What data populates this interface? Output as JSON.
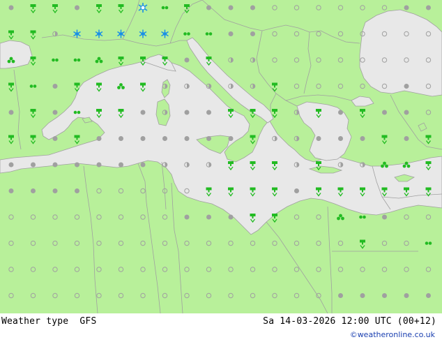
{
  "footer": {
    "title": "Weather type",
    "model": "GFS",
    "datetime": "Sa 14-03-2026 12:00 UTC (00+12)",
    "credit": "©weatheronline.co.uk"
  },
  "colors": {
    "land": "#b8f09a",
    "sea": "#e8e8e8",
    "border": "#a0a0a0",
    "rain": "#22bb22",
    "snow": "#1a8fe6",
    "dot": "#a0a0a0"
  },
  "symbols_legend": {
    "dot_filled": "cloudy",
    "dot_open": "clear",
    "dot_half": "partly cloudy",
    "rain_icon": "rain",
    "snow_icon": "snow",
    "drizzle_icon": "drizzle",
    "shower_icon": "showers"
  },
  "grid_symbols": [
    [
      "d",
      "r",
      "r",
      "f",
      "r",
      "r",
      "s",
      "dz",
      "r",
      "f",
      "f",
      "f",
      "o",
      "o",
      "o",
      "o",
      "o",
      "o",
      "f",
      "f"
    ],
    [
      "r",
      "r",
      "h",
      "sn",
      "sn",
      "sn",
      "sn",
      "sn",
      "dz",
      "dz",
      "f",
      "f",
      "o",
      "o",
      "o",
      "o",
      "o",
      "o",
      "o",
      "o"
    ],
    [
      "sh",
      "r",
      "dz",
      "dz",
      "sh",
      "r",
      "r",
      "r",
      "f",
      "r",
      "h",
      "h",
      "o",
      "o",
      "o",
      "o",
      "o",
      "o",
      "o",
      "o"
    ],
    [
      "r",
      "dz",
      "f",
      "r",
      "r",
      "sh",
      "r",
      "h",
      "h",
      "h",
      "h",
      "h",
      "r",
      "o",
      "o",
      "o",
      "o",
      "o",
      "f",
      "o"
    ],
    [
      "f",
      "r",
      "f",
      "dz",
      "r",
      "r",
      "f",
      "h",
      "f",
      "f",
      "r",
      "r",
      "r",
      "h",
      "r",
      "f",
      "r",
      "f",
      "f",
      "o"
    ],
    [
      "r",
      "r",
      "f",
      "r",
      "f",
      "f",
      "f",
      "f",
      "f",
      "f",
      "f",
      "r",
      "h",
      "h",
      "f",
      "f",
      "f",
      "r",
      "f",
      "r"
    ],
    [
      "f",
      "f",
      "f",
      "f",
      "f",
      "f",
      "f",
      "h",
      "h",
      "h",
      "r",
      "r",
      "r",
      "h",
      "r",
      "h",
      "h",
      "sh",
      "sh",
      "r"
    ],
    [
      "f",
      "f",
      "f",
      "f",
      "o",
      "o",
      "o",
      "o",
      "o",
      "r",
      "r",
      "r",
      "r",
      "f",
      "r",
      "r",
      "r",
      "r",
      "r",
      "r"
    ],
    [
      "o",
      "o",
      "o",
      "o",
      "o",
      "o",
      "o",
      "o",
      "f",
      "f",
      "f",
      "r",
      "r",
      "o",
      "o",
      "sh",
      "dz",
      "f",
      "o",
      "o"
    ],
    [
      "o",
      "o",
      "o",
      "o",
      "o",
      "o",
      "o",
      "o",
      "o",
      "o",
      "o",
      "o",
      "o",
      "o",
      "o",
      "o",
      "r",
      "o",
      "o",
      "dz"
    ],
    [
      "o",
      "o",
      "o",
      "o",
      "o",
      "o",
      "o",
      "o",
      "o",
      "o",
      "o",
      "o",
      "o",
      "o",
      "o",
      "o",
      "o",
      "o",
      "o",
      "o"
    ],
    [
      "o",
      "o",
      "o",
      "o",
      "o",
      "o",
      "o",
      "o",
      "o",
      "o",
      "o",
      "o",
      "o",
      "o",
      "o",
      "f",
      "f",
      "f",
      "f",
      "f"
    ],
    [
      "o",
      "o",
      "o",
      "o",
      "o",
      "o",
      "o",
      "o",
      "o",
      "o",
      "o",
      "o",
      "o",
      "o",
      "o",
      "f",
      "f",
      "f",
      "f",
      "f"
    ]
  ]
}
